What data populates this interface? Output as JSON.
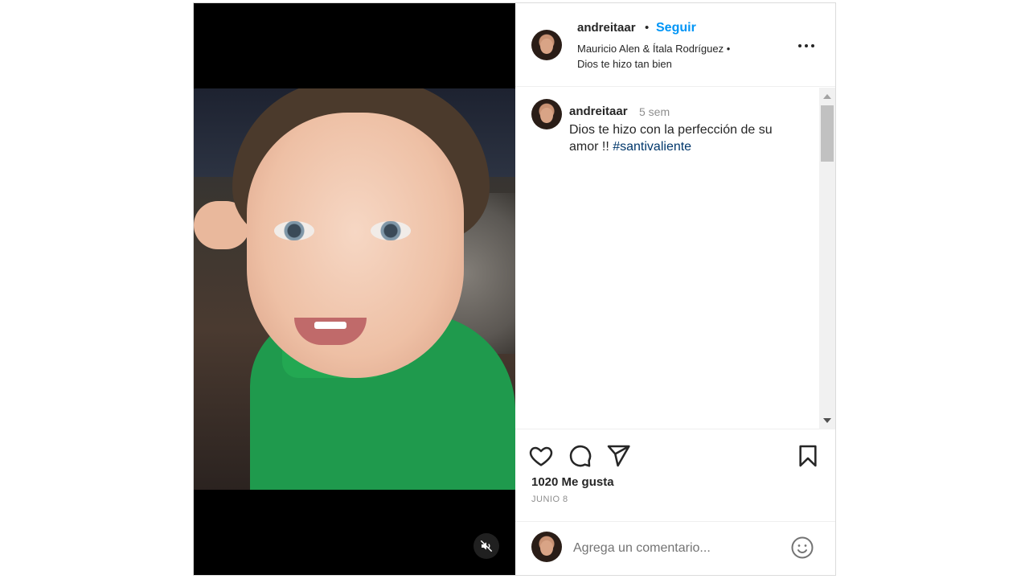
{
  "header": {
    "username": "andreitaar",
    "separator": "•",
    "follow_label": "Seguir",
    "audio": "Mauricio Alen & Ítala Rodríguez •",
    "location": "Dios te hizo tan bien"
  },
  "caption": {
    "username": "andreitaar",
    "time": "5 sem",
    "text": "Dios te hizo con la perfección de su amor !! ",
    "hashtag": "#santivaliente"
  },
  "stats": {
    "likes": "1020 Me gusta",
    "date": "JUNIO 8"
  },
  "comment_box": {
    "placeholder": "Agrega un comentario..."
  },
  "icons": {
    "like": "heart-icon",
    "comment": "comment-bubble-icon",
    "share": "paper-plane-icon",
    "save": "bookmark-icon",
    "emoji": "emoji-icon",
    "mute": "speaker-muted-icon",
    "more": "more-horizontal-icon"
  },
  "colors": {
    "follow": "#0095f6",
    "hashtag": "#00376b",
    "muted_text": "#8e8e8e"
  }
}
